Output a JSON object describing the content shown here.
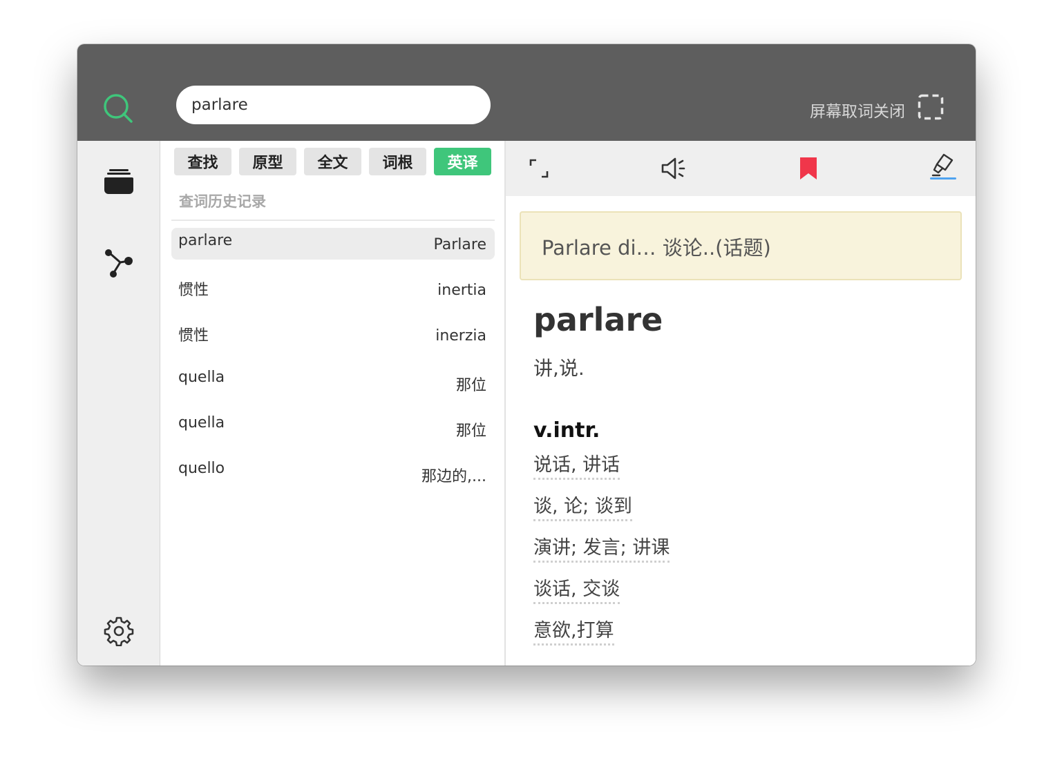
{
  "search": {
    "value": "parlare"
  },
  "header": {
    "screen_lookup_label": "屏幕取词关闭"
  },
  "icons": {
    "logo": "search-icon",
    "screen_lookup": "dashed-square-icon",
    "rail": [
      "folder-stack-icon",
      "share-node-icon",
      "gear-icon"
    ],
    "toolbar": [
      "fullscreen-icon",
      "speaker-icon",
      "bookmark-icon",
      "highlighter-icon"
    ]
  },
  "colors": {
    "titlebar": "#5e5e5e",
    "accent_green": "#3fc67b",
    "bookmark_red": "#f0364a",
    "underline_blue": "#4ea3f0",
    "phrase_bg": "#f8f3dc"
  },
  "tabs": [
    {
      "label": "查找",
      "active": false
    },
    {
      "label": "原型",
      "active": false
    },
    {
      "label": "全文",
      "active": false
    },
    {
      "label": "词根",
      "active": false
    },
    {
      "label": "英译",
      "active": true
    }
  ],
  "history": {
    "title": "查词历史记录",
    "items": [
      {
        "word": "parlare",
        "meaning": "Parlare",
        "selected": true
      },
      {
        "word": "惯性",
        "meaning": "inertia",
        "selected": false
      },
      {
        "word": "惯性",
        "meaning": "inerzia",
        "selected": false
      },
      {
        "word": "quella",
        "meaning": "那位",
        "selected": false
      },
      {
        "word": "quella",
        "meaning": "那位",
        "selected": false
      },
      {
        "word": "quello",
        "meaning": "那边的,...",
        "selected": false
      }
    ]
  },
  "entry": {
    "phrase": "Parlare di… 谈论..(话题)",
    "headword": "parlare",
    "meaning": "讲,说.",
    "pos": "v.intr.",
    "senses": [
      "说话, 讲话",
      "谈, 论; 谈到",
      "演讲; 发言; 讲课",
      "谈话, 交谈",
      "意欲,打算"
    ]
  }
}
